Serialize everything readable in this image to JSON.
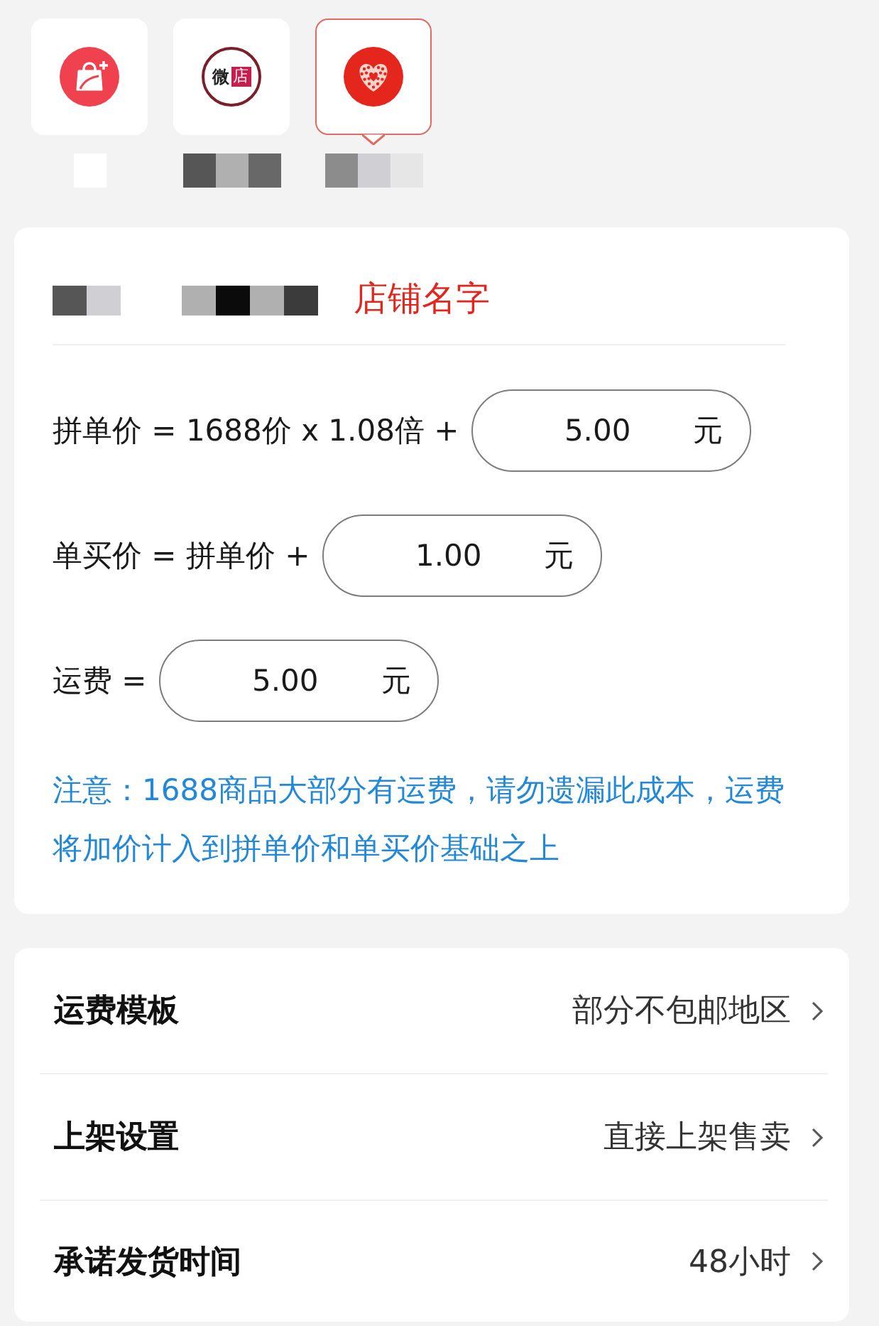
{
  "platforms": [
    {
      "logo": {
        "kind": "bag"
      },
      "selected": false,
      "name_redacted": true
    },
    {
      "logo": {
        "kind": "text",
        "text": "微",
        "tag": "店"
      },
      "selected": false,
      "name_redacted": true
    },
    {
      "logo": {
        "kind": "heart"
      },
      "selected": true,
      "name_redacted": true
    }
  ],
  "store": {
    "label_redacted": true,
    "value_redacted": true,
    "name": "店铺名字"
  },
  "price_rows": [
    {
      "label": "拼单价 = 1688价 x 1.08倍 +",
      "value": "5.00",
      "unit": "元"
    },
    {
      "label": "单买价 = 拼单价 +",
      "value": "1.00",
      "unit": "元"
    },
    {
      "label": "运费 =",
      "value": "5.00",
      "unit": "元"
    }
  ],
  "note": "注意：1688商品大部分有运费，请勿遗漏此成本，运费将加价计入到拼单价和单买价基础之上",
  "settings": [
    {
      "label": "运费模板",
      "value": "部分不包邮地区"
    },
    {
      "label": "上架设置",
      "value": "直接上架售卖"
    },
    {
      "label": "承诺发货时间",
      "value": "48小时"
    }
  ]
}
